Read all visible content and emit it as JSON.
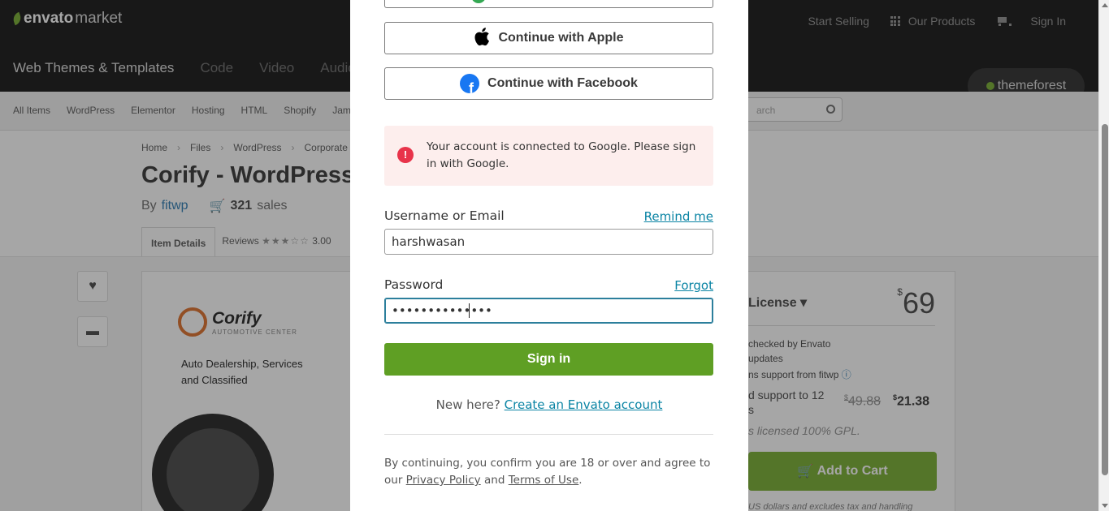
{
  "header": {
    "logo_brand": "envato",
    "logo_product": "market",
    "links": [
      "Start Selling",
      "Our Products",
      "Sign In"
    ],
    "categories": [
      "Web Themes & Templates",
      "Code",
      "Video",
      "Audio"
    ],
    "marketplace_badge": "themeforest"
  },
  "subnav": {
    "items": [
      "All Items",
      "WordPress",
      "Elementor",
      "Hosting",
      "HTML",
      "Shopify",
      "Jam"
    ],
    "search_placeholder": "arch"
  },
  "item": {
    "breadcrumb": [
      "Home",
      "Files",
      "WordPress",
      "Corporate"
    ],
    "title": "Corify - WordPress",
    "by_label": "By",
    "author": "fitwp",
    "sales_count": "321",
    "sales_label": "sales",
    "tab_details": "Item Details",
    "tab_reviews": "Reviews",
    "rating_value": "3.00",
    "rating": 3,
    "rating_max": 5
  },
  "preview": {
    "brand": "Corify",
    "brand_sub": "AUTOMOTIVE CENTER",
    "tagline": "Auto Dealership, Services and Classified"
  },
  "pricing": {
    "license_label": "License",
    "currency": "$",
    "price": "69",
    "feature_1": "checked by Envato",
    "feature_2": "updates",
    "feature_3": "ns support from fitwp",
    "support_line_1": "d support to 12",
    "support_line_2": "s",
    "old_price": "49.88",
    "new_price": "21.38",
    "gpl_note": "s licensed 100% GPL.",
    "add_to_cart": "Add to Cart",
    "tax_note": "US dollars and excludes tax and handling"
  },
  "modal": {
    "continue_apple": "Continue with Apple",
    "continue_facebook": "Continue with Facebook",
    "alert_message": "Your account is connected to Google. Please sign in with Google.",
    "username_label": "Username or Email",
    "remind_link": "Remind me",
    "username_value": "harshwasan",
    "password_label": "Password",
    "forgot_link": "Forgot",
    "password_value": "••••••••••••••",
    "sign_in_button": "Sign in",
    "new_here_text": "New here?",
    "create_account_link": "Create an Envato account",
    "legal_prefix": "By continuing, you confirm you are 18 or over and agree to our",
    "privacy_link": "Privacy Policy",
    "legal_and": "and",
    "terms_link": "Terms of Use",
    "legal_suffix": "."
  },
  "colors": {
    "signin_green": "#5f9f24",
    "link_teal": "#0a84a4",
    "alert_red": "#e8334a",
    "alert_bg": "#fdeeed",
    "facebook_blue": "#1877f2"
  }
}
